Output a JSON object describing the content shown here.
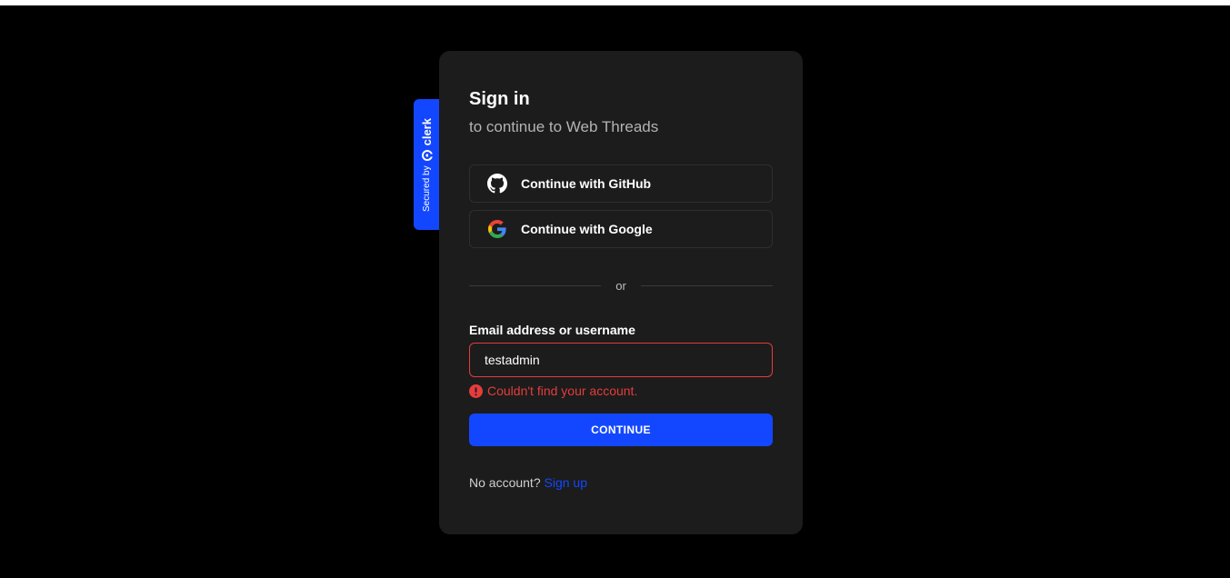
{
  "badge": {
    "secured_text": "Secured by",
    "brand": "clerk",
    "logo_icon": "clerk-logo-icon",
    "color": "#1347ff"
  },
  "signin": {
    "title": "Sign in",
    "subtitle": "to continue to Web Threads",
    "social": [
      {
        "label": "Continue with GitHub",
        "icon": "github-icon"
      },
      {
        "label": "Continue with Google",
        "icon": "google-icon"
      }
    ],
    "divider_text": "or",
    "email_label": "Email address or username",
    "email_value": "testadmin",
    "error_text": "Couldn't find your account.",
    "error_icon": "error-circle-icon",
    "continue_label": "CONTINUE",
    "footer_text": "No account?",
    "signup_link": "Sign up"
  },
  "colors": {
    "accent": "#1347ff",
    "error": "#e53c3c",
    "card_bg": "#1c1c1c",
    "page_bg": "#000000"
  }
}
